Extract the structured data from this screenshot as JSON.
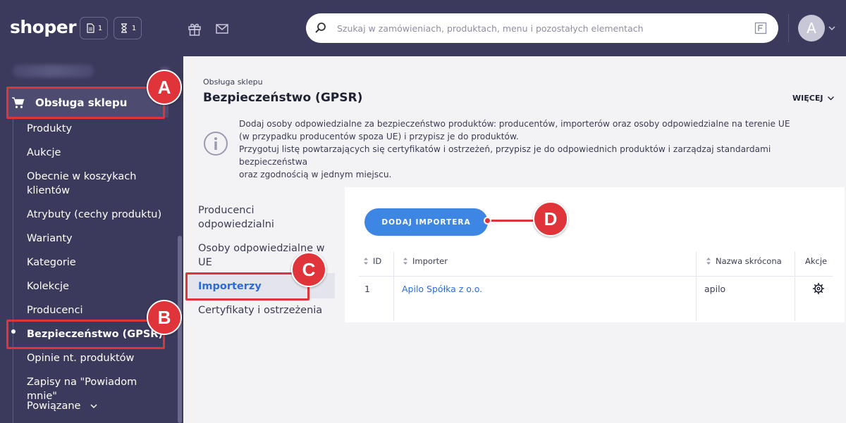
{
  "header": {
    "logo": "shoper",
    "counters": [
      {
        "icon": "document-icon",
        "count": "1"
      },
      {
        "icon": "hourglass-icon",
        "count": "1"
      }
    ],
    "search_placeholder": "Szukaj w zamówieniach, produktach, menu i pozostałych elementach",
    "avatar_letter": "A"
  },
  "sidebar": {
    "section_label": "Obsługa sklepu",
    "items": [
      {
        "label": "Produkty"
      },
      {
        "label": "Aukcje"
      },
      {
        "label": "Obecnie w koszykach klientów"
      },
      {
        "label": "Atrybuty (cechy produktu)"
      },
      {
        "label": "Warianty"
      },
      {
        "label": "Kategorie"
      },
      {
        "label": "Kolekcje"
      },
      {
        "label": "Producenci"
      },
      {
        "label": "Bezpieczeństwo (GPSR)",
        "active": true
      },
      {
        "label": "Opinie nt. produktów"
      },
      {
        "label": "Zapisy na \"Powiadom mnie\""
      },
      {
        "label": "Powiązane"
      }
    ]
  },
  "page": {
    "breadcrumb": "Obsługa sklepu",
    "title": "Bezpieczeństwo (GPSR)",
    "more_label": "WIĘCEJ",
    "info_lines": [
      "Dodaj osoby odpowiedzialne za bezpieczeństwo produktów: producentów, importerów oraz osoby odpowiedzialne na terenie UE",
      "(w przypadku producentów spoza UE) i przypisz je do produktów.",
      "Przygotuj listę powtarzających się certyfikatów i ostrzeżeń, przypisz je do odpowiednich produktów i zarządzaj standardami bezpieczeństwa",
      "oraz zgodnością w jednym miejscu."
    ]
  },
  "tabs": [
    {
      "label": "Producenci odpowiedzialni"
    },
    {
      "label": "Osoby odpowiedzialne w UE"
    },
    {
      "label": "Importerzy",
      "active": true
    },
    {
      "label": "Certyfikaty i ostrzeżenia"
    }
  ],
  "panel": {
    "add_button": "DODAJ IMPORTERA",
    "columns": [
      "ID",
      "Importer",
      "Nazwa skrócona",
      "Akcje"
    ],
    "rows": [
      {
        "id": "1",
        "importer": "Apilo Spółka z o.o.",
        "short_name": "apilo"
      }
    ]
  },
  "annotations": [
    "A",
    "B",
    "C",
    "D"
  ],
  "colors": {
    "nav_bg": "#3b3a5c",
    "accent_blue": "#3d86e4",
    "link_blue": "#2d6cd6",
    "annotation_red": "#e0343b"
  }
}
